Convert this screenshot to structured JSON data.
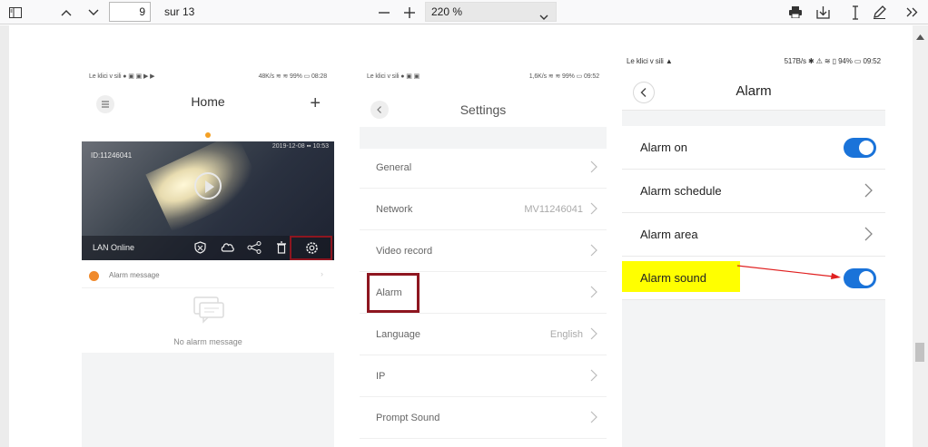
{
  "toolbar": {
    "page_current": "9",
    "page_total": "sur 13",
    "zoom": "220 %"
  },
  "phone_home": {
    "status_left": "Le klici v sili ● ▣ ▣ ▶ ▶",
    "status_right": "48K/s ≋ ≋ 99% ▭ 08:28",
    "title": "Home",
    "device_id": "ID:11246041",
    "timestamp": "2019-12-08 ▪▪ 10:53",
    "lan_status": "LAN Online",
    "alarm_message": "Alarm message",
    "no_alarm": "No alarm message"
  },
  "phone_settings": {
    "status_left": "Le klici v sili ● ▣ ▣",
    "status_right": "1,6K/s ≋ ≋ 99% ▭ 09:52",
    "title": "Settings",
    "items": [
      {
        "label": "General",
        "value": ""
      },
      {
        "label": "Network",
        "value": "MV11246041"
      },
      {
        "label": "Video record",
        "value": ""
      },
      {
        "label": "Alarm",
        "value": ""
      },
      {
        "label": "Language",
        "value": "English"
      },
      {
        "label": "IP",
        "value": ""
      },
      {
        "label": "Prompt Sound",
        "value": ""
      }
    ]
  },
  "phone_alarm": {
    "status_left": "Le klici v sili ▲",
    "status_right": "517B/s ✱ ⚠ ≋ ▯ 94% ▭ 09:52",
    "title": "Alarm",
    "items": [
      {
        "label": "Alarm on",
        "type": "toggle",
        "on": true
      },
      {
        "label": "Alarm schedule",
        "type": "chevron"
      },
      {
        "label": "Alarm area",
        "type": "chevron"
      },
      {
        "label": "Alarm sound",
        "type": "toggle",
        "on": true
      }
    ]
  },
  "colors": {
    "toggle_on": "#1a73d9",
    "highlight": "#ffff00",
    "annotation_box": "#8e1620",
    "arrow": "#e02020"
  }
}
